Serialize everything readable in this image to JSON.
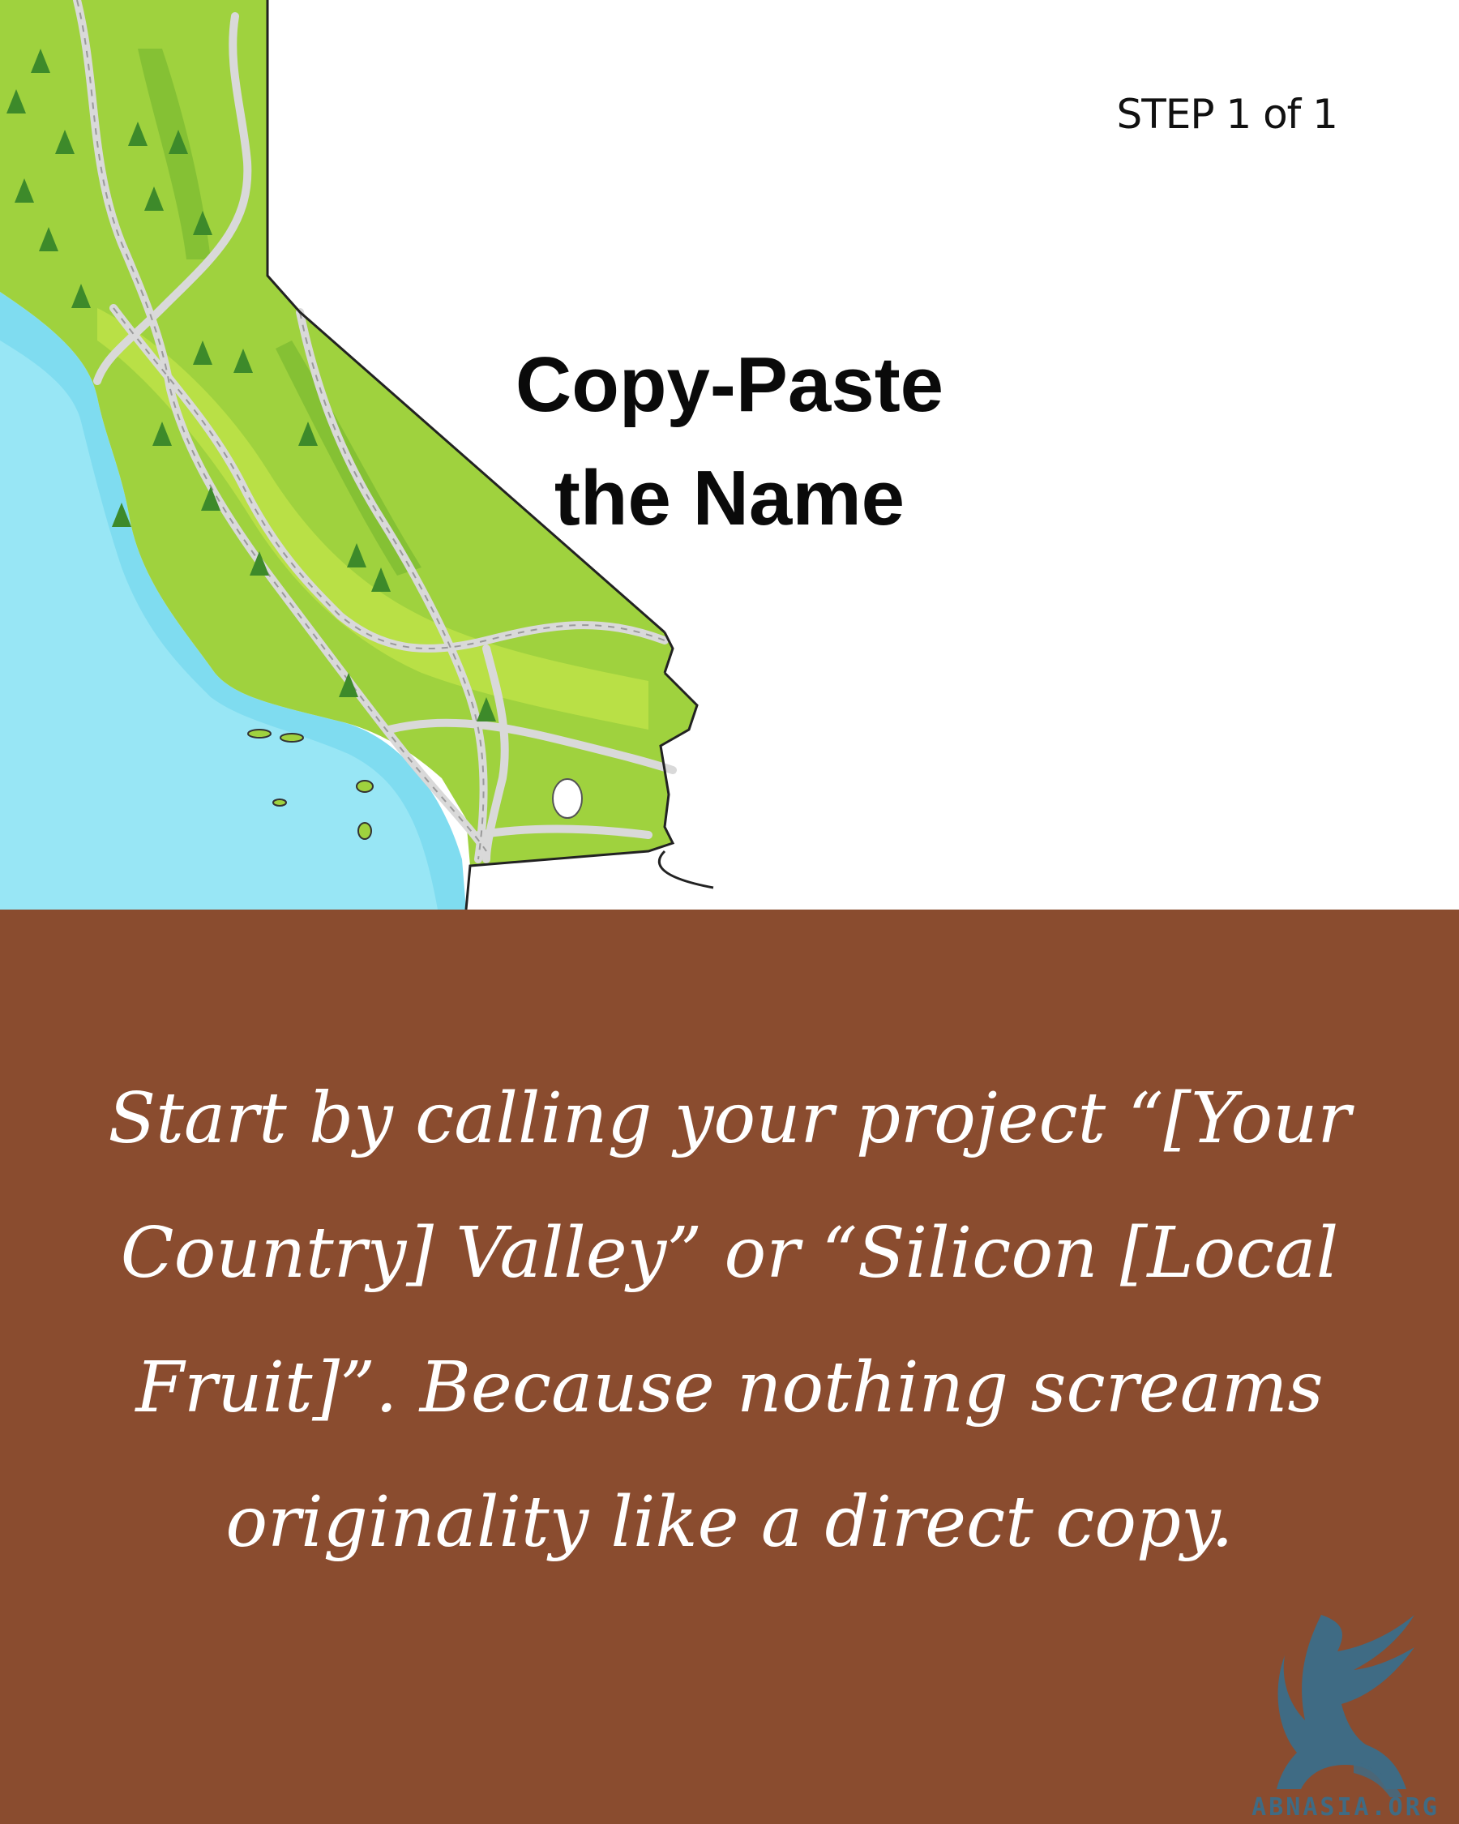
{
  "header": {
    "step_label": "STEP 1 of 1",
    "title_line1": "Copy-Paste",
    "title_line2": "the Name"
  },
  "caption": {
    "text": "Start by calling your project “[Your Country] Valley” or “Silicon [Local Fruit]”. Because nothing screams originality like a direct copy."
  },
  "branding": {
    "logo_icon": "griffin-logo-icon",
    "site": "ABNASIA.ORG"
  },
  "colors": {
    "ocean": "#7fdcf0",
    "land": "#9fd23e",
    "road": "#d9d9d9",
    "caption_background": "#8a4c2f",
    "logo": "#3f6b84"
  }
}
